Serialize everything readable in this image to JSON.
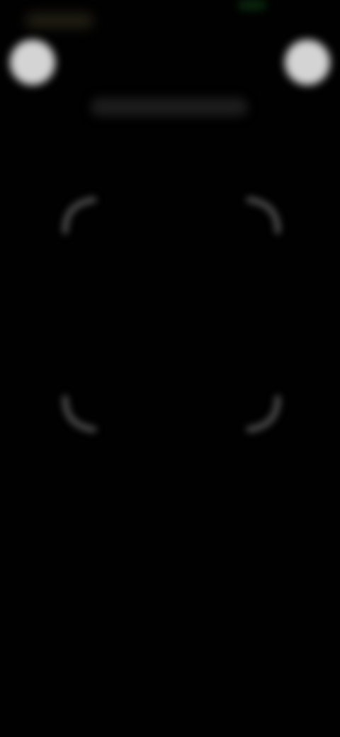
{
  "screen": {
    "background": "#010101"
  },
  "status_bar": {
    "left_blur_color": "#3a3320",
    "indicator_color": "#0f3a14"
  },
  "toolbar": {
    "left_button_icon": "circle-button-icon",
    "right_button_icon": "circle-button-icon",
    "button_color": "#d4d4d4"
  },
  "title_placeholder": {
    "color": "#1c1c1c"
  },
  "scan_frame": {
    "corner_color": "#4a4a4a",
    "corner_icons": [
      "corner-top-left-icon",
      "corner-top-right-icon",
      "corner-bottom-left-icon",
      "corner-bottom-right-icon"
    ]
  }
}
